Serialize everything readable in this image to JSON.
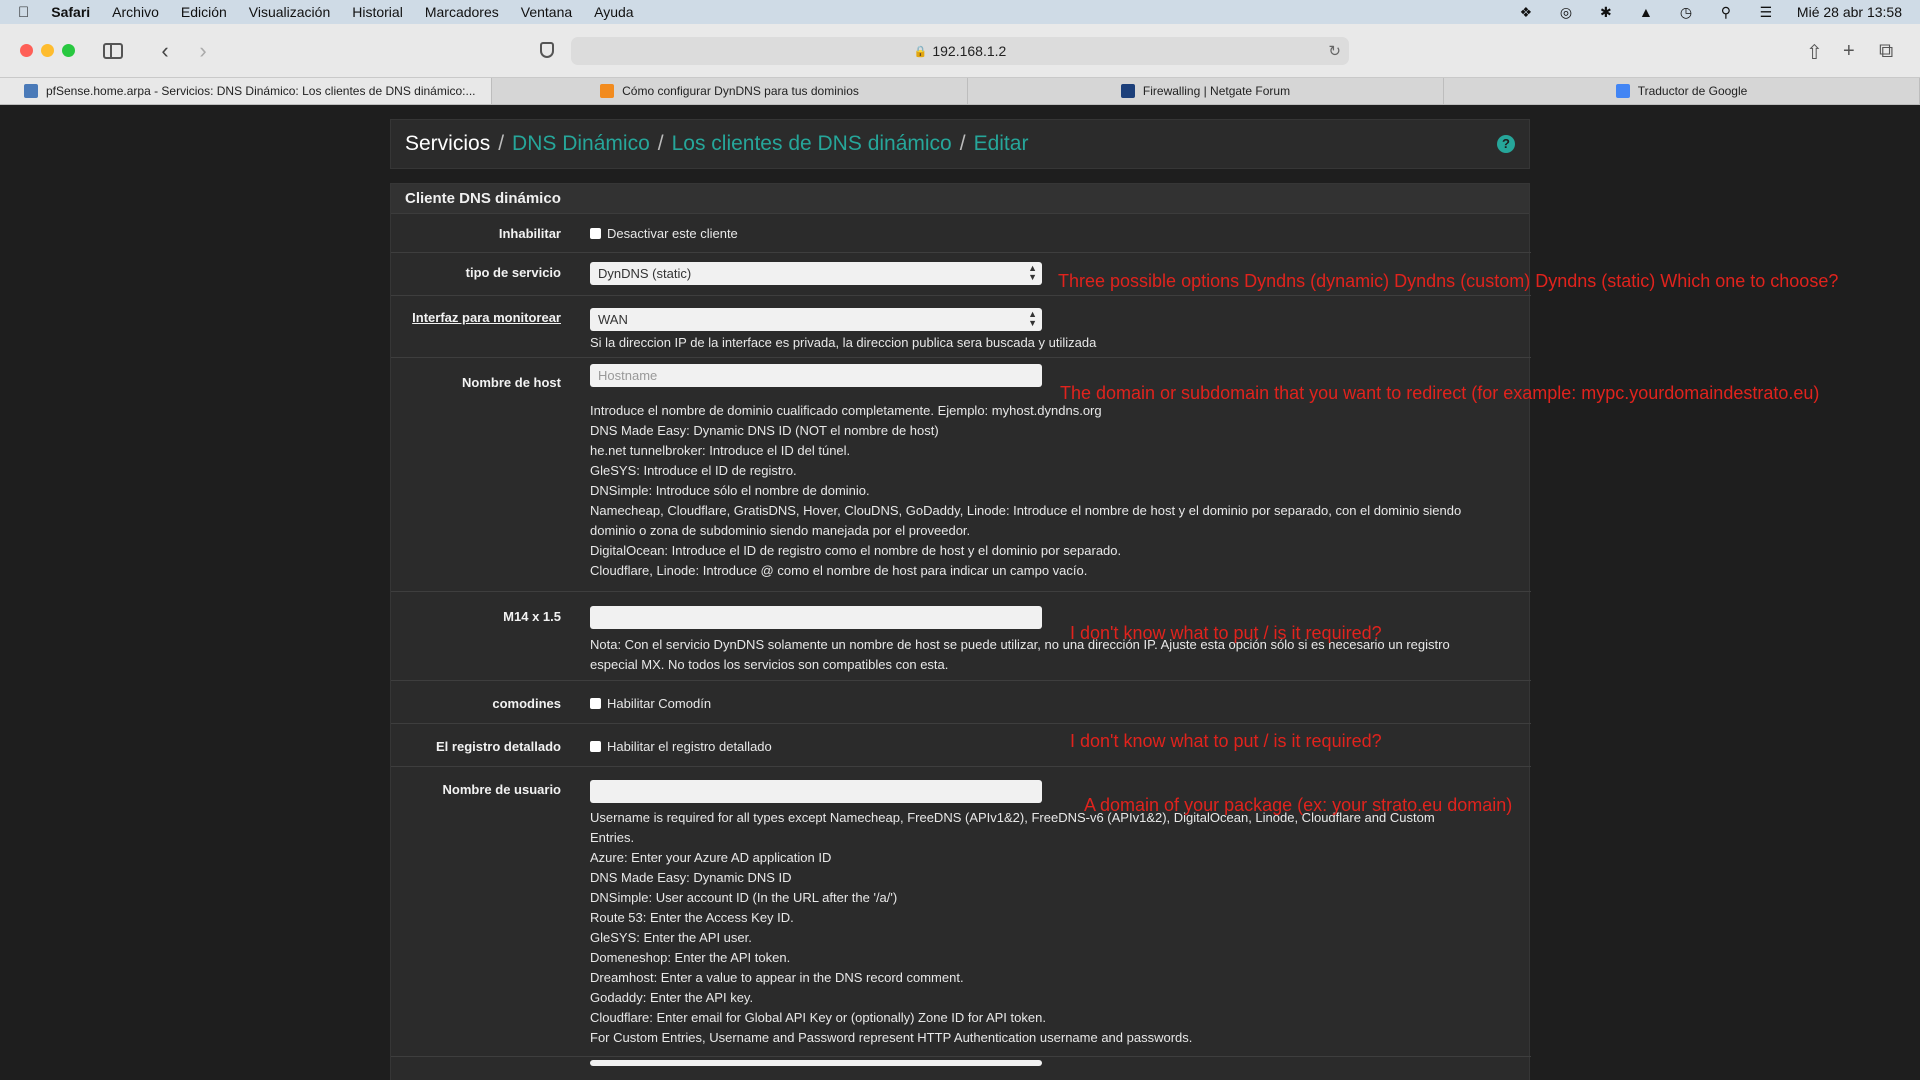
{
  "menubar": {
    "app_name": "Safari",
    "items": [
      "Archivo",
      "Edición",
      "Visualización",
      "Historial",
      "Marcadores",
      "Ventana",
      "Ayuda"
    ],
    "clock": "Mié 28 abr  13:58"
  },
  "browser": {
    "url": "192.168.1.2",
    "tabs": [
      {
        "title": "pfSense.home.arpa - Servicios: DNS Dinámico: Los clientes de DNS dinámico:...",
        "icon": "pfsense-icon"
      },
      {
        "title": "Cómo configurar DynDNS para tus dominios",
        "icon": "strato-icon"
      },
      {
        "title": "Firewalling | Netgate Forum",
        "icon": "netgate-icon"
      },
      {
        "title": "Traductor de Google",
        "icon": "google-translate-icon"
      }
    ]
  },
  "breadcrumb": {
    "root": "Servicios",
    "links": [
      "DNS Dinámico",
      "Los clientes de DNS dinámico",
      "Editar"
    ],
    "separator": "/"
  },
  "panel": {
    "title": "Cliente DNS dinámico",
    "rows": {
      "disable": {
        "label": "Inhabilitar",
        "checkbox_label": "Desactivar este cliente"
      },
      "service_type": {
        "label": "tipo de servicio",
        "value": "DynDNS (static)"
      },
      "interface": {
        "label": "Interfaz para monitorear",
        "value": "WAN",
        "help": "Si la direccion IP de la interface es privada, la direccion publica sera buscada y utilizada"
      },
      "hostname": {
        "label": "Nombre de host",
        "placeholder": "Hostname",
        "help": [
          "Introduce el nombre de dominio cualificado completamente. Ejemplo: myhost.dyndns.org",
          "DNS Made Easy: Dynamic DNS ID (NOT el nombre de host)",
          "he.net tunnelbroker: Introduce el ID del túnel.",
          "GleSYS: Introduce el ID de registro.",
          "DNSimple: Introduce sólo el nombre de dominio.",
          "Namecheap, Cloudflare, GratisDNS, Hover, ClouDNS, GoDaddy, Linode: Introduce el nombre de host y el dominio por separado, con el dominio siendo",
          "dominio o zona de subdominio siendo manejada por el proveedor.",
          "DigitalOcean: Introduce el ID de registro como el nombre de host y el dominio por separado.",
          "Cloudflare, Linode: Introduce @ como el nombre de host para indicar un campo vacío."
        ]
      },
      "mx": {
        "label": "M14 x 1.5",
        "help": [
          "Nota: Con el servicio DynDNS solamente un nombre de host se puede utilizar, no una dirección IP. Ajuste esta opción sólo si es necesario un registro",
          "especial MX. No todos los servicios son compatibles con esta."
        ]
      },
      "wildcards": {
        "label": "comodines",
        "checkbox_label": "Habilitar Comodín"
      },
      "verbose": {
        "label": "El registro detallado",
        "checkbox_label": "Habilitar el registro detallado"
      },
      "username": {
        "label": "Nombre de usuario",
        "help": [
          "Username is required for all types except Namecheap, FreeDNS (APIv1&2), FreeDNS-v6 (APIv1&2), DigitalOcean, Linode, Cloudflare and Custom",
          "Entries.",
          "Azure: Enter your Azure AD application ID",
          "DNS Made Easy: Dynamic DNS ID",
          "DNSimple: User account ID (In the URL after the '/a/')",
          "Route 53: Enter the Access Key ID.",
          "GleSYS: Enter the API user.",
          "Domeneshop: Enter the API token.",
          "Dreamhost: Enter a value to appear in the DNS record comment.",
          "Godaddy: Enter the API key.",
          "Cloudflare: Enter email for Global API Key or (optionally) Zone ID for API token.",
          "For Custom Entries, Username and Password represent HTTP Authentication username and passwords."
        ]
      }
    }
  },
  "annotations": {
    "service_type": "Three possible options Dyndns (dynamic) Dyndns (custom) Dyndns (static) Which one to choose?",
    "hostname": "The domain or subdomain that you want to redirect (for example: mypc.yourdomaindestrato.eu)",
    "mx": "I don't know what to put / is it required?",
    "wildcards": "I don't know what to put / is it required?",
    "username": "A domain of your package (ex: your strato.eu domain)"
  },
  "colors": {
    "accent": "#26a69a",
    "annotation": "#e0231d",
    "background": "#1e1e1e",
    "panel": "#2b2b2b"
  }
}
